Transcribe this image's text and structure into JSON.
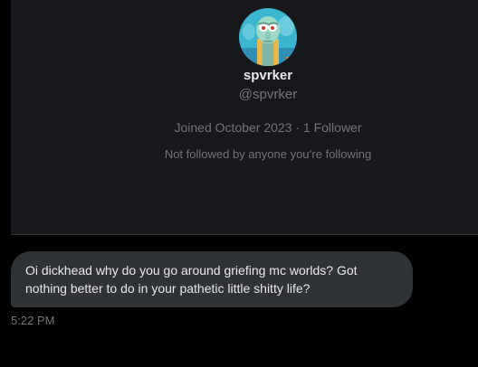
{
  "profile": {
    "display_name": "spvrker",
    "handle": "@spvrker",
    "joined": "Joined October 2023",
    "separator": "·",
    "followers": "1 Follower",
    "followed_note": "Not followed by anyone you’re following",
    "avatar_icon": "cartoon-character-avatar-icon"
  },
  "message": {
    "text": "Oi dickhead why do you go around griefing mc worlds? Got nothing better to do in your pathetic little shitty life?",
    "time": "5:22 PM"
  },
  "colors": {
    "background": "#000000",
    "card_background": "#16181c",
    "bubble_background": "#2f3336",
    "primary_text": "#e7e9ea",
    "secondary_text": "#71767b"
  }
}
